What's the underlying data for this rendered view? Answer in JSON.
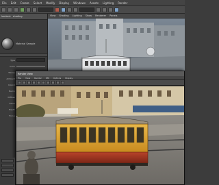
{
  "app": {
    "menubar": [
      "File",
      "Edit",
      "Create",
      "Select",
      "Modify",
      "Display",
      "Windows",
      "Assets",
      "Lighting",
      "Render"
    ],
    "accent_color": "#7fa2c8"
  },
  "shelf": {
    "tools": [
      "select-icon",
      "lasso-icon",
      "paint-icon",
      "move-icon",
      "rotate-icon",
      "scale-icon",
      "render-icon",
      "ipr-icon",
      "render-settings-icon",
      "hypershade-icon"
    ]
  },
  "attribute_editor": {
    "tabs": [
      "lambert",
      "shading"
    ],
    "material_label": "Material Sample",
    "rows": [
      {
        "label": "Type",
        "kind": "field"
      },
      {
        "label": "Color",
        "kind": "slider"
      },
      {
        "label": "Transp",
        "kind": "slider"
      },
      {
        "label": "Ambient",
        "kind": "slider"
      },
      {
        "label": "Incand",
        "kind": "slider"
      },
      {
        "label": "Bump",
        "kind": "field"
      },
      {
        "label": "Diffuse",
        "kind": "white"
      },
      {
        "label": "Transl",
        "kind": "slider"
      },
      {
        "label": "Depth",
        "kind": "slider"
      },
      {
        "label": "Focus",
        "kind": "slider"
      }
    ],
    "section_label": "Common Material Attributes"
  },
  "viewport": {
    "menu": [
      "View",
      "Shading",
      "Lighting",
      "Show",
      "Renderer",
      "Panels"
    ]
  },
  "render_view": {
    "title": "Render View",
    "menu": [
      "File",
      "View",
      "Render",
      "IPR",
      "Options",
      "Display"
    ]
  }
}
